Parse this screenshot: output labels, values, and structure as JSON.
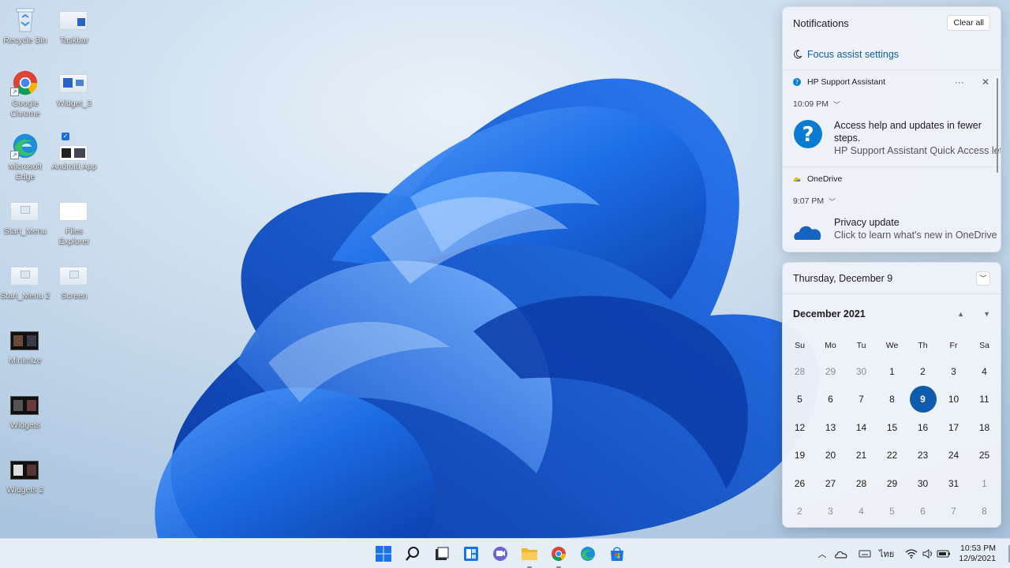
{
  "desktop": {
    "icons": [
      {
        "label": "Recycle Bin"
      },
      {
        "label": "Taskbar"
      },
      {
        "label": "Google Chrome"
      },
      {
        "label": "Widget_3"
      },
      {
        "label": "Microsoft Edge"
      },
      {
        "label": "Android App"
      },
      {
        "label": "Start_Menu"
      },
      {
        "label": "Files Explorer"
      },
      {
        "label": "Start_Menu 2"
      },
      {
        "label": "Screen"
      },
      {
        "label": "Minimize"
      },
      {
        "label": "Widgets"
      },
      {
        "label": "Widgets 2"
      }
    ]
  },
  "notifications": {
    "title": "Notifications",
    "clear_all": "Clear all",
    "focus_assist": "Focus assist settings",
    "items": [
      {
        "app": "HP Support Assistant",
        "time": "10:09 PM",
        "title": "Access help and updates in fewer steps.",
        "body": "HP Support Assistant Quick Access lets",
        "icon": "question-circle-icon"
      },
      {
        "app": "OneDrive",
        "time": "9:07 PM",
        "title": "Privacy update",
        "body": "Click to learn what's new in OneDrive",
        "icon": "cloud-icon"
      }
    ]
  },
  "calendar": {
    "date_header": "Thursday, December 9",
    "month": "December 2021",
    "weekdays": [
      "Su",
      "Mo",
      "Tu",
      "We",
      "Th",
      "Fr",
      "Sa"
    ],
    "days": [
      "28",
      "29",
      "30",
      "1",
      "2",
      "3",
      "4",
      "5",
      "6",
      "7",
      "8",
      "9",
      "10",
      "11",
      "12",
      "13",
      "14",
      "15",
      "16",
      "17",
      "18",
      "19",
      "20",
      "21",
      "22",
      "23",
      "24",
      "25",
      "26",
      "27",
      "28",
      "29",
      "30",
      "31",
      "1",
      "2",
      "3",
      "4",
      "5",
      "6",
      "7",
      "8"
    ],
    "first_current_index": 3,
    "last_current_index": 33,
    "today": "9"
  },
  "taskbar": {
    "apps": [
      "start-icon",
      "search-icon",
      "task-view-icon",
      "widgets-icon",
      "chat-icon",
      "file-explorer-icon",
      "chrome-icon",
      "edge-icon",
      "store-icon"
    ],
    "language": "ไทย",
    "time": "10:53 PM",
    "date": "12/9/2021"
  },
  "colors": {
    "accent": "#0f5cae",
    "wallpaper_bg": "#c9dcec",
    "bloom": "#1f6ee8"
  }
}
